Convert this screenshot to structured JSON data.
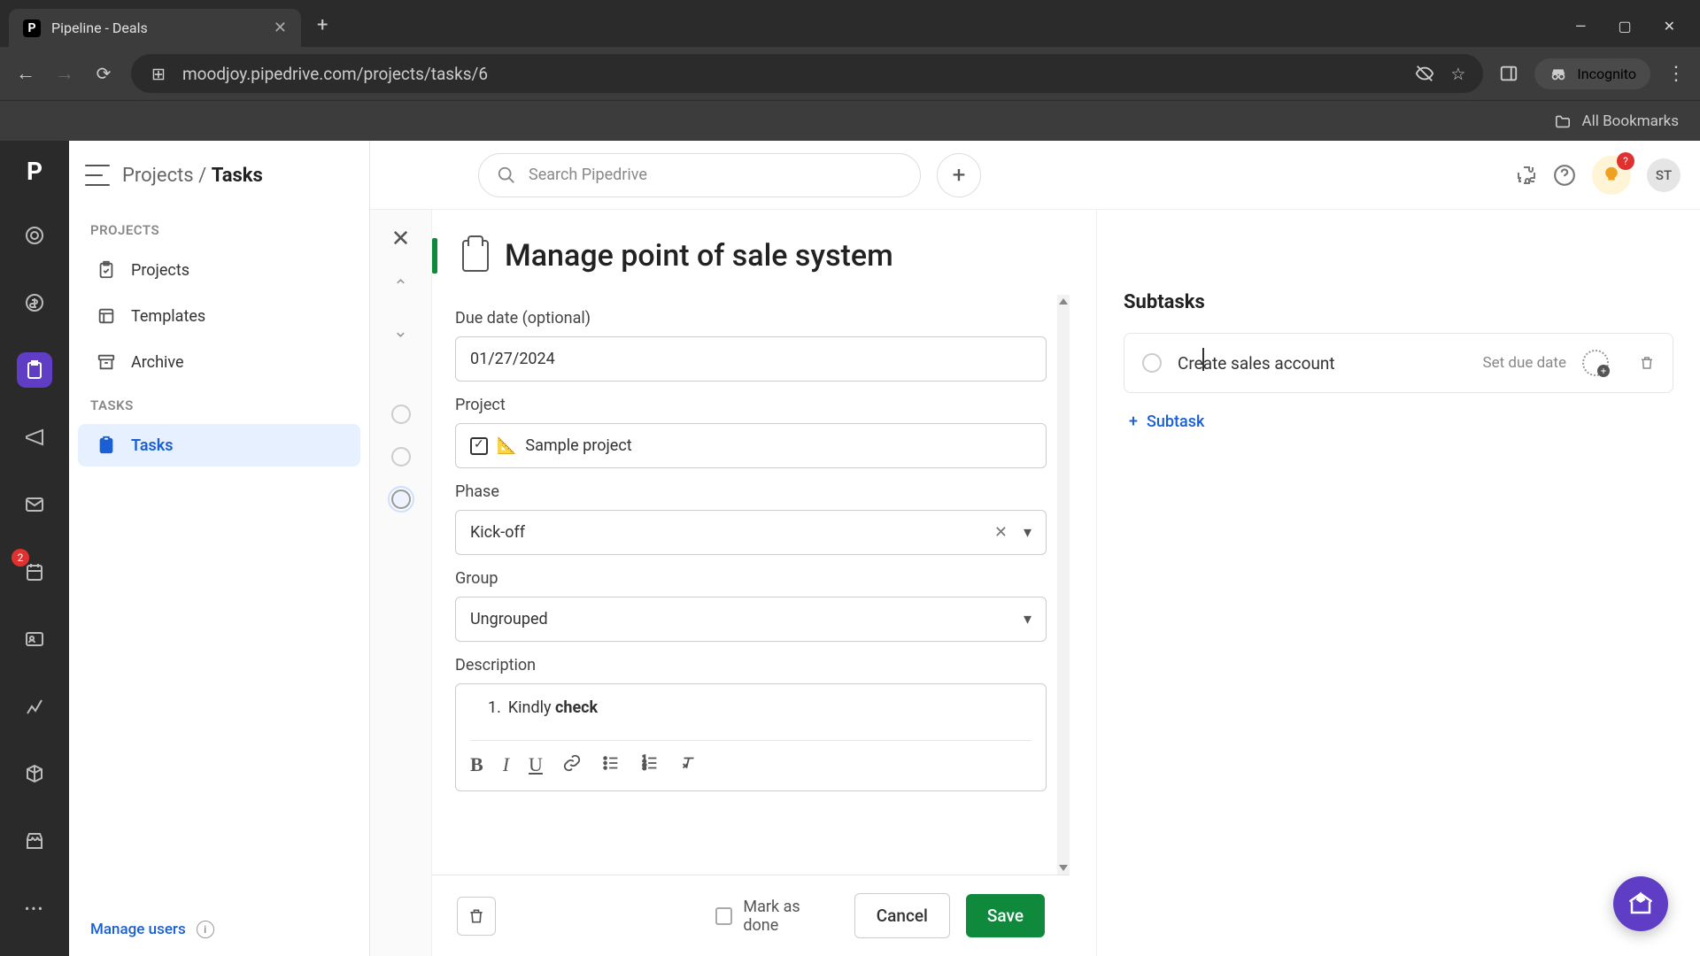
{
  "browser": {
    "tab_title": "Pipeline - Deals",
    "url": "moodjoy.pipedrive.com/projects/tasks/6",
    "incognito_label": "Incognito",
    "all_bookmarks": "All Bookmarks"
  },
  "header": {
    "breadcrumb_root": "Projects",
    "breadcrumb_current": "Tasks",
    "search_placeholder": "Search Pipedrive",
    "avatar_initials": "ST",
    "bulb_badge": "?"
  },
  "sidebar": {
    "section1": "PROJECTS",
    "items1": [
      "Projects",
      "Templates",
      "Archive"
    ],
    "section2": "TASKS",
    "items2": [
      "Tasks"
    ],
    "manage_users": "Manage users"
  },
  "rail": {
    "badge_count": "2"
  },
  "task": {
    "title": "Manage point of sale system",
    "due_date_label": "Due date (optional)",
    "due_date_value": "01/27/2024",
    "project_label": "Project",
    "project_value": "Sample project",
    "phase_label": "Phase",
    "phase_value": "Kick-off",
    "group_label": "Group",
    "group_value": "Ungrouped",
    "description_label": "Description",
    "description_prefix": "1.",
    "description_text": "Kindly ",
    "description_bold": "check"
  },
  "footer": {
    "mark_done": "Mark as done",
    "cancel": "Cancel",
    "save": "Save"
  },
  "subtasks": {
    "heading": "Subtasks",
    "item_text": "Create sales account",
    "set_due": "Set due date",
    "add_label": "Subtask"
  }
}
